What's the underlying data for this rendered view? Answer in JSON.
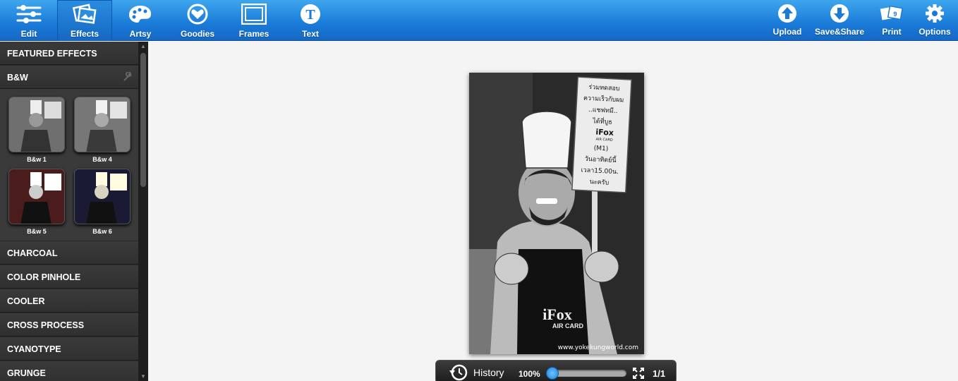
{
  "toolbar": {
    "left": [
      {
        "label": "Edit",
        "icon": "sliders-icon"
      },
      {
        "label": "Effects",
        "icon": "photos-icon",
        "active": true
      },
      {
        "label": "Artsy",
        "icon": "palette-icon"
      },
      {
        "label": "Goodies",
        "icon": "heart-circle-icon"
      },
      {
        "label": "Frames",
        "icon": "frame-icon"
      },
      {
        "label": "Text",
        "icon": "text-t-icon"
      }
    ],
    "right": [
      {
        "label": "Upload",
        "icon": "upload-icon"
      },
      {
        "label": "Save&Share",
        "icon": "download-icon"
      },
      {
        "label": "Print",
        "icon": "print-icon"
      },
      {
        "label": "Options",
        "icon": "gear-icon"
      }
    ]
  },
  "sidebar": {
    "featured": "FEATURED EFFECTS",
    "bw": "B&W",
    "thumbs": [
      {
        "label": "B&w 1",
        "tint": "#6f6f6f"
      },
      {
        "label": "B&w 4",
        "tint": "#777777"
      },
      {
        "label": "B&w 5",
        "tint": "#5a2020"
      },
      {
        "label": "B&w 6",
        "tint": "#1a1a3a"
      }
    ],
    "categories": [
      "CHARCOAL",
      "COLOR PINHOLE",
      "COOLER",
      "CROSS PROCESS",
      "CYANOTYPE",
      "GRUNGE"
    ]
  },
  "photo": {
    "sign_lines": [
      "ร่วมทดสอบ",
      "ความเร็วกับผม",
      "..แชฟทมี..",
      "ได้ที่บูธ",
      "iFox",
      "AIR CARD",
      "(M1)",
      "วันอาทิตย์นี้",
      "เวลา15.00น.",
      "นะครับ"
    ],
    "apron_brand": "iFox",
    "apron_sub": "AIR CARD",
    "watermark": "www.yokekungworld.com"
  },
  "history": {
    "label": "History",
    "zoom": "100%",
    "zoom_fraction": 0.0,
    "page": "1/1"
  }
}
